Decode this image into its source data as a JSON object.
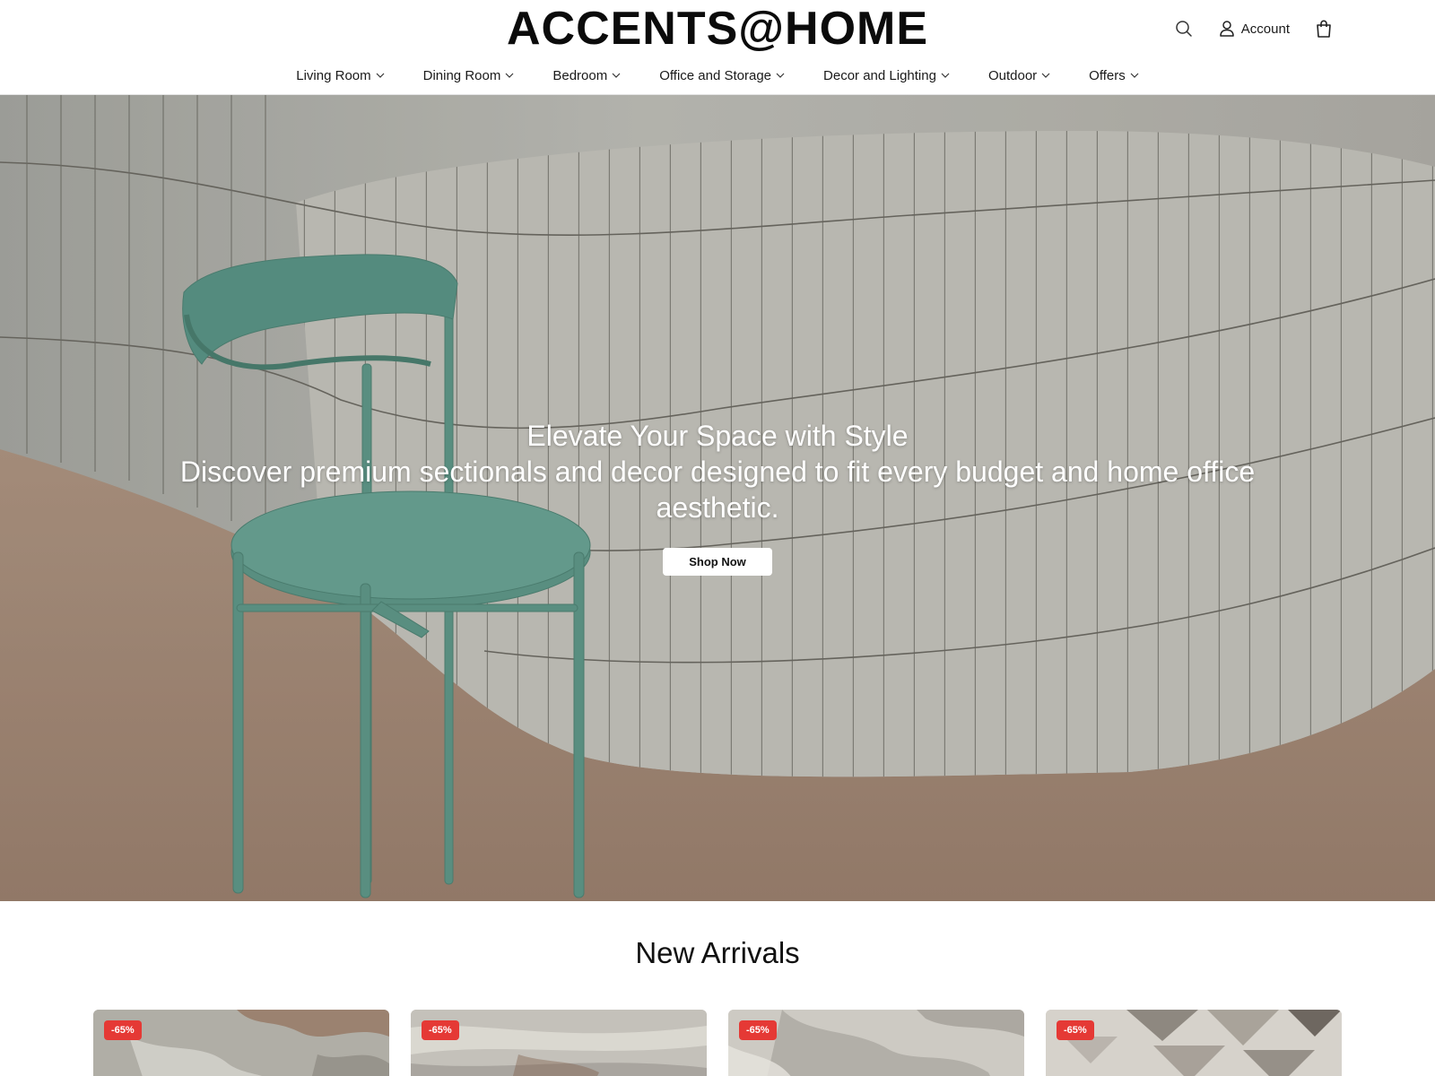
{
  "header": {
    "logo": "ACCENTS@HOME",
    "account_label": "Account",
    "icons": {
      "search": "search-icon",
      "account": "user-icon",
      "cart": "shopping-bag-icon"
    }
  },
  "nav": {
    "items": [
      {
        "label": "Living Room"
      },
      {
        "label": "Dining Room"
      },
      {
        "label": "Bedroom"
      },
      {
        "label": "Office and Storage"
      },
      {
        "label": "Decor and Lighting"
      },
      {
        "label": "Outdoor"
      },
      {
        "label": "Offers"
      }
    ]
  },
  "hero": {
    "title": "Elevate Your Space with Style",
    "subtitle": "Discover premium sectionals and decor designed to fit every budget and home office aesthetic.",
    "cta_label": "Shop Now"
  },
  "arrivals": {
    "title": "New Arrivals",
    "products": [
      {
        "badge": "-65%"
      },
      {
        "badge": "-65%"
      },
      {
        "badge": "-65%"
      },
      {
        "badge": "-65%"
      }
    ]
  },
  "colors": {
    "badge": "#e53935",
    "chair": "#5f9a8c",
    "floor": "#a88a76",
    "wall": "#b9b8b2"
  }
}
